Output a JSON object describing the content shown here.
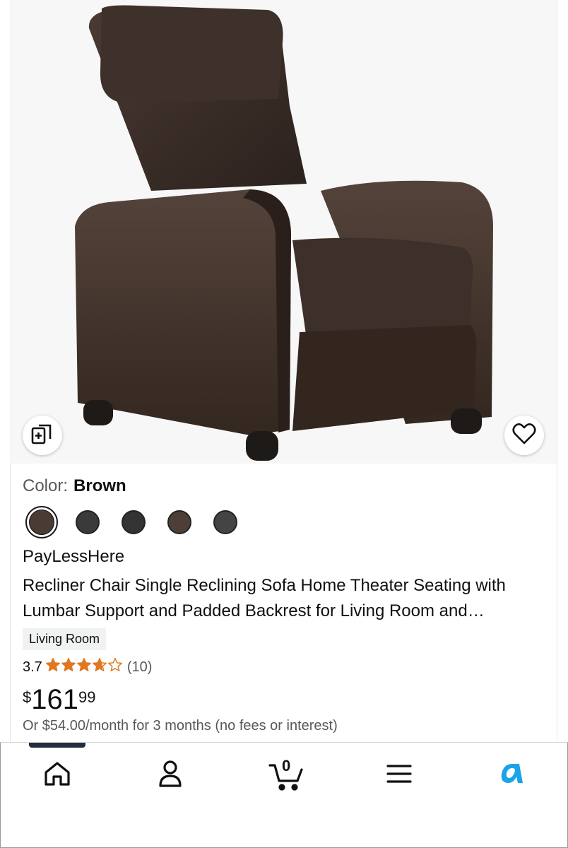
{
  "product": {
    "color_label": "Color:",
    "color_value": "Brown",
    "swatch_colors": [
      "#4a3b35",
      "#3a3a3a",
      "#333333",
      "#4d3e38",
      "#444444"
    ],
    "brand": "PayLessHere",
    "title": "Recliner Chair Single Reclining Sofa Home Theater Seating with Lumbar Support and Padded Backrest for Living Room and…",
    "badge": "Living Room",
    "rating_value": "3.7",
    "rating_stars": 3.7,
    "review_count": "(10)",
    "price_currency": "$",
    "price_whole": "161",
    "price_fraction": "99",
    "monthly_offer": "Or $54.00/month for 3 months (no fees or interest)"
  },
  "icons": {
    "compare": "compare-icon",
    "favorite": "heart-icon",
    "home": "home-icon",
    "account": "user-icon",
    "cart": "cart-icon",
    "menu": "menu-icon",
    "alexa": "alexa-icon"
  },
  "cart_count": "0",
  "colors": {
    "star": "#de7921",
    "hero_bg": "#f7f7f7",
    "alexa": "#1aa3e8"
  }
}
